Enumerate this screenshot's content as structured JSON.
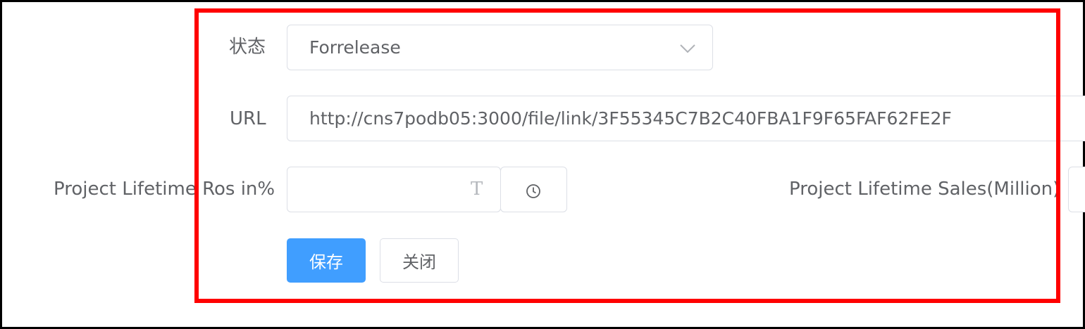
{
  "form": {
    "status": {
      "label": "状态",
      "value": "Forrelease",
      "icon": "chevron-down-icon"
    },
    "url": {
      "label": "URL",
      "value": "http://cns7podb05:3000/file/link/3F55345C7B2C40FBA1F9F65FAF62FE2F"
    },
    "ros": {
      "label": "Project Lifetime Ros in%",
      "value": "",
      "text_icon": "T",
      "clock_icon": "clock-icon"
    },
    "sales": {
      "label": "Project Lifetime Sales(Million)",
      "value": ""
    },
    "buttons": {
      "save_label": "保存",
      "close_label": "关闭"
    }
  },
  "colors": {
    "primary": "#409eff",
    "highlight": "#ff0000",
    "label": "#606266",
    "border": "#dcdfe6"
  }
}
